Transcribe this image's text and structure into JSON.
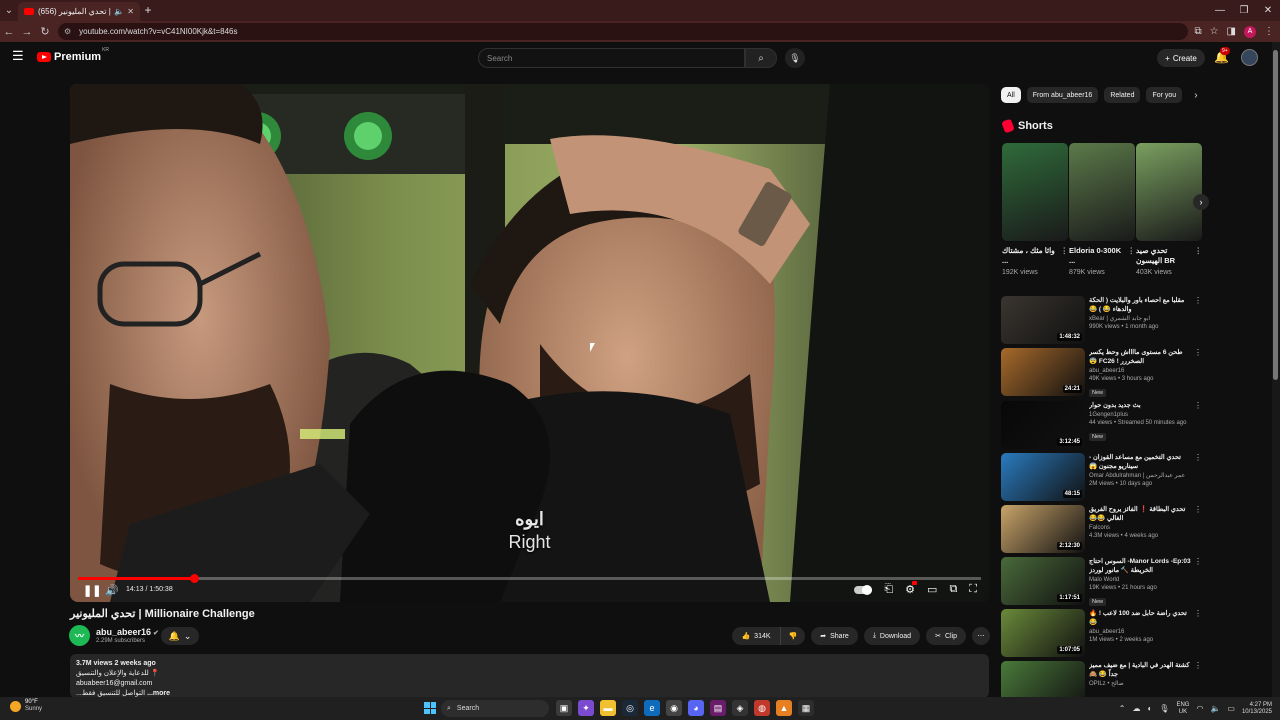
{
  "browser": {
    "tab_title": "(656) تحدي المليونير | Millionaire Challenge - YouTube",
    "url": "youtube.com/watch?v=vC41NI00Kjk&t=846s"
  },
  "header": {
    "logo_text": "Premium",
    "region_code": "KR",
    "search_placeholder": "Search",
    "create_label": "Create",
    "notif_count": "9+"
  },
  "player": {
    "subtitle_arabic": "ايوه",
    "subtitle_english": "Right",
    "time": "14:13 / 1:50:38",
    "progress_fraction": 0.1286
  },
  "video": {
    "title": "تحدي المليونير | Millionaire Challenge",
    "channel": "abu_abeer16",
    "subscribers": "2.29M subscribers",
    "likes": "314K",
    "share_label": "Share",
    "download_label": "Download",
    "clip_label": "Clip",
    "description": {
      "meta": "3.7M views  2 weeks ago",
      "line1": "للدعاية والإعلان والتنسيق 📍",
      "line2": "abuabeer16@gmail.com",
      "line3": "...التواصل للتنسيق فقط ",
      "more": "...more"
    }
  },
  "sidebar": {
    "chips": [
      "All",
      "From abu_abeer16",
      "Related",
      "For you"
    ],
    "shorts_heading": "Shorts",
    "shorts": [
      {
        "title": "واثا مثك ، مشتاك ...",
        "views": "192K views",
        "color": "#2f6b3a"
      },
      {
        "title": "Eldoria 0-300K ...",
        "views": "879K views",
        "color": "#5c7a4a"
      },
      {
        "title": "تحدي صيد الهيسون BR",
        "views": "403K views",
        "color": "#7aa060"
      }
    ],
    "recommended": [
      {
        "title": "مقلبا مع احصاء باور والبلايت ( الحكة والدهاء 😂 ) 😂",
        "channel": "xBear | ابو جابد الشمري",
        "views": "990K views • 1 month ago",
        "duration": "1:48:32",
        "badge": "",
        "color": "#3a3530"
      },
      {
        "title": "طحن 6 مستوى مااااش وحظ يكسر الصخررر ! FC26 😨",
        "channel": "abu_abeer16",
        "views": "49K views • 3 hours ago",
        "duration": "24:21",
        "badge": "New",
        "color": "#a86a2a"
      },
      {
        "title": "بث جديد بدون حوار",
        "channel": "1Gengen1plus",
        "views": "44 views • Streamed 50 minutes ago",
        "duration": "3:12:45",
        "badge": "New",
        "color": "#080808"
      },
      {
        "title": "تحدي التخمين مع مساعد القوزان - سيناريو مجنون 😱",
        "channel": "Omar Abdulrahman | عمر عبدالرحمن",
        "views": "2M views • 10 days ago",
        "duration": "48:15",
        "badge": "",
        "color": "#2a7bbf"
      },
      {
        "title": "تحدي البطاقة ❗ الفائز يروح الفريق الغالي 😂😂",
        "channel": "Falcons",
        "views": "4.3M views • 4 weeks ago",
        "duration": "2:12:30",
        "badge": "",
        "color": "#c9a46a"
      },
      {
        "title": "Manor Lords -Ep:03- السوس احتاج الخريطة 🔨 مانور لوردز",
        "channel": "Malo World",
        "views": "19K views • 21 hours ago",
        "duration": "1:17:51",
        "badge": "New",
        "color": "#4a6a3a"
      },
      {
        "title": "تحدي راضة حابل ضد 100 لاعب ! 🔥 😂",
        "channel": "abu_abeer16",
        "views": "1M views • 2 weeks ago",
        "duration": "1:07:05",
        "badge": "",
        "color": "#6a8a3a"
      },
      {
        "title": "كشتة الهدر في البادية | مع ضيف مميز جداً 😂 🙈",
        "channel": "OPILz • صالح",
        "views": "",
        "duration": "",
        "badge": "",
        "color": "#4a7a3a"
      }
    ]
  },
  "taskbar": {
    "temp": "90°F",
    "weather": "Sunny",
    "search_label": "Search",
    "lang1": "ENG",
    "lang2": "UK",
    "time": "4:27 PM",
    "date": "10/13/2025"
  }
}
